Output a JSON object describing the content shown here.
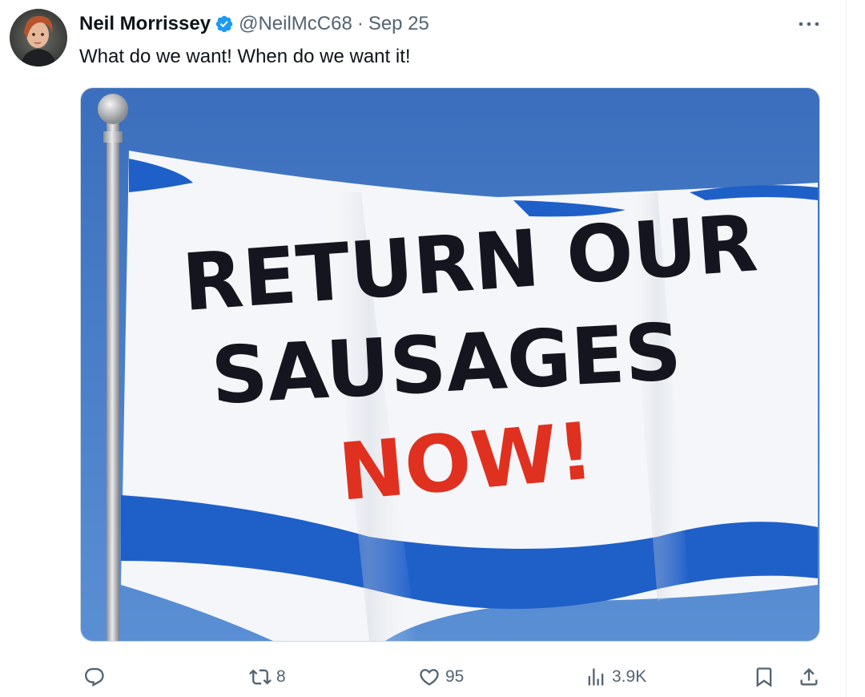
{
  "tweet": {
    "author": {
      "display_name": "Neil Morrissey",
      "verified": true,
      "handle": "@NeilMcC68",
      "avatar_icon": "profile-photo"
    },
    "separator": "·",
    "date": "Sep 25",
    "text": "What do we want! When do we want it!",
    "media": {
      "flag_text": [
        "RETURN OUR",
        "SAUSAGES",
        "NOW!"
      ],
      "colors": {
        "sky": "#3e73c0",
        "flag_white": "#f4f6f9",
        "stripe_blue": "#1f5fc8",
        "text_dark": "#15151f",
        "text_red": "#e0301f"
      }
    },
    "actions": {
      "reply": {
        "icon": "reply-icon",
        "count": ""
      },
      "repost": {
        "icon": "repost-icon",
        "count": "8"
      },
      "like": {
        "icon": "heart-icon",
        "count": "95"
      },
      "views": {
        "icon": "analytics-icon",
        "count": "3.9K"
      },
      "bookmark": {
        "icon": "bookmark-icon"
      },
      "share": {
        "icon": "share-icon"
      }
    },
    "colors": {
      "text_primary": "#0f1419",
      "text_secondary": "#536471",
      "verified_blue": "#1d9bf0",
      "border": "#cfd9de"
    }
  }
}
